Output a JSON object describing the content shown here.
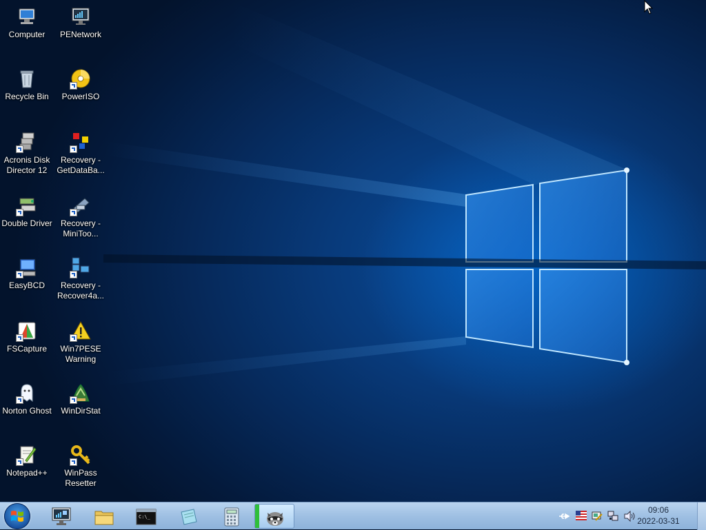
{
  "desktop": {
    "icons": [
      {
        "label": "Computer",
        "icon": "computer-icon"
      },
      {
        "label": "PENetwork",
        "icon": "network-icon"
      },
      {
        "label": "Recycle Bin",
        "icon": "recycle-bin-icon"
      },
      {
        "label": "PowerISO",
        "icon": "poweriso-icon"
      },
      {
        "label": "Acronis Disk Director 12",
        "icon": "acronis-icon"
      },
      {
        "label": "Recovery - GetDataBa...",
        "icon": "getdataback-icon"
      },
      {
        "label": "Double Driver",
        "icon": "double-driver-icon"
      },
      {
        "label": "Recovery - MiniToo...",
        "icon": "minitool-icon"
      },
      {
        "label": "EasyBCD",
        "icon": "easybcd-icon"
      },
      {
        "label": "Recovery - Recover4a...",
        "icon": "recover4all-icon"
      },
      {
        "label": "FSCapture",
        "icon": "fscapture-icon"
      },
      {
        "label": "Win7PESE Warning",
        "icon": "warning-icon"
      },
      {
        "label": "Norton Ghost",
        "icon": "norton-ghost-icon"
      },
      {
        "label": "WinDirStat",
        "icon": "windirstat-icon"
      },
      {
        "label": "Notepad++",
        "icon": "notepad-plus-plus-icon"
      },
      {
        "label": "WinPass Resetter",
        "icon": "winpass-key-icon"
      }
    ]
  },
  "taskbar": {
    "pinned": [
      "network-monitor-icon",
      "folder-icon",
      "command-prompt-icon",
      "notepad-icon",
      "calculator-icon",
      "raccoon-app-icon"
    ],
    "active_app": "raccoon-app-icon",
    "tray": [
      "usb-icon",
      "us-flag-icon",
      "tray-tool-icon",
      "network-tray-icon",
      "volume-icon"
    ],
    "clock": {
      "time": "09:06",
      "date": "2022-03-31"
    }
  },
  "colors": {
    "accent": "#1c6fd6",
    "taskbar": "#a9c7e8"
  }
}
